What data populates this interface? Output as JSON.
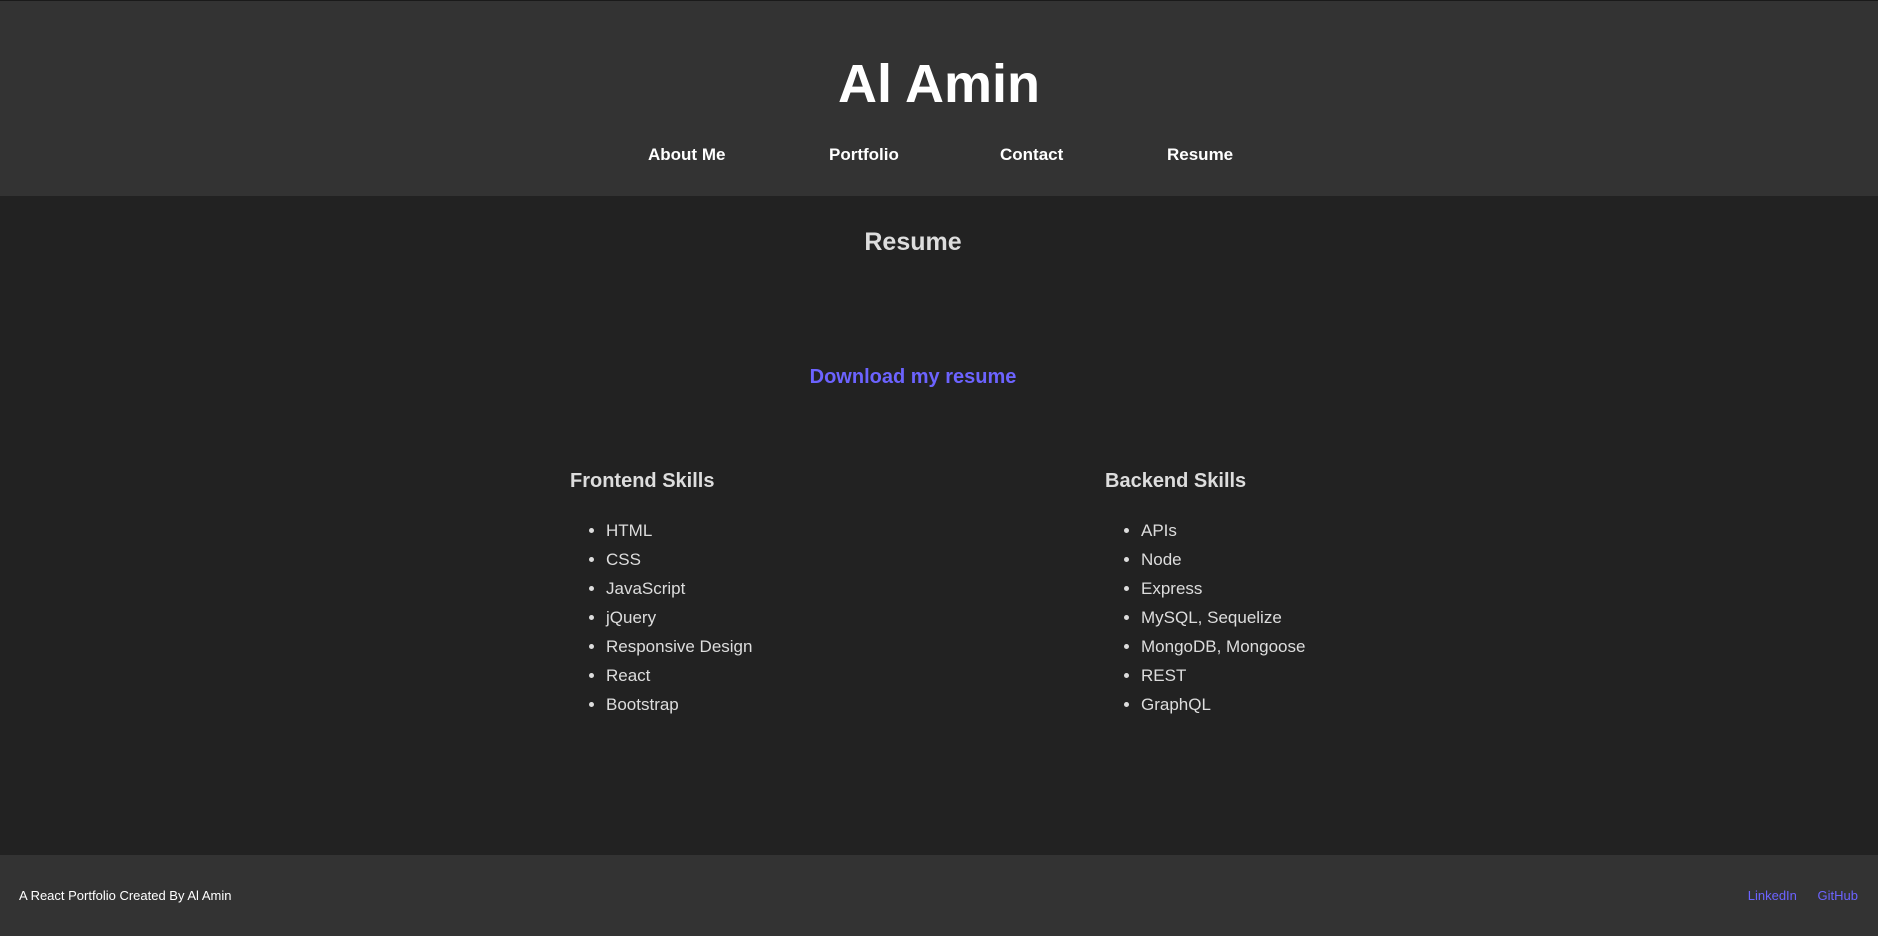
{
  "header": {
    "title": "Al Amin",
    "nav": [
      {
        "label": "About Me"
      },
      {
        "label": "Portfolio"
      },
      {
        "label": "Contact"
      },
      {
        "label": "Resume"
      }
    ]
  },
  "main": {
    "heading": "Resume",
    "download_label": "Download my resume",
    "frontend": {
      "title": "Frontend Skills",
      "items": [
        "HTML",
        "CSS",
        "JavaScript",
        "jQuery",
        "Responsive Design",
        "React",
        "Bootstrap"
      ]
    },
    "backend": {
      "title": "Backend Skills",
      "items": [
        "APIs",
        "Node",
        "Express",
        "MySQL, Sequelize",
        "MongoDB, Mongoose",
        "REST",
        "GraphQL"
      ]
    }
  },
  "footer": {
    "credit": "A React Portfolio Created By Al Amin",
    "links": [
      {
        "label": "LinkedIn"
      },
      {
        "label": "GitHub"
      }
    ]
  },
  "colors": {
    "header_bg": "#333333",
    "body_bg": "#222222",
    "accent": "#6c63ff",
    "text": "#dddddd"
  }
}
